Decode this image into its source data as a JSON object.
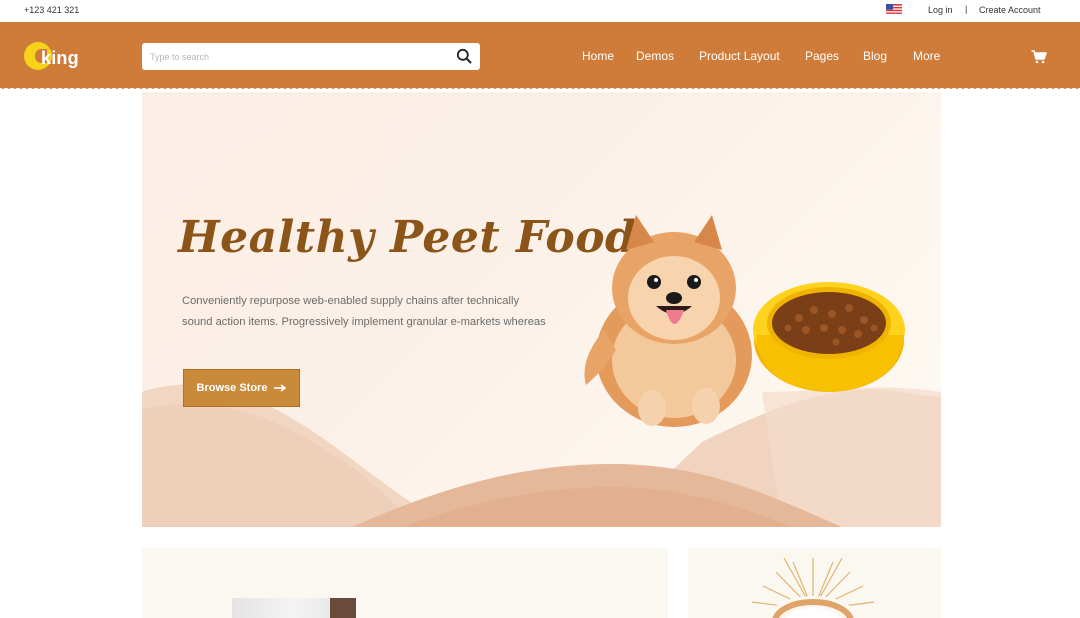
{
  "topbar": {
    "phone": "+123 421 321",
    "login": "Log in",
    "separator": "|",
    "create_account": "Create Account"
  },
  "header": {
    "logo_text": "king",
    "search_placeholder": "Type to search",
    "menu": [
      "Home",
      "Demos",
      "Product Layout",
      "Pages",
      "Blog",
      "More"
    ]
  },
  "hero": {
    "title": "Healthy Peet Food",
    "text_line1": "Conveniently repurpose web-enabled supply chains after technically",
    "text_line2": "sound action items. Progressively implement granular e-markets whereas",
    "button_label": "Browse Store"
  },
  "colors": {
    "brand": "#cf7c3a",
    "button": "#c98a3a",
    "title": "#8b5418",
    "logo_yellow": "#f6d21a"
  },
  "icons": [
    "flag-us-icon",
    "search-icon",
    "cart-icon",
    "arrow-right-icon"
  ]
}
